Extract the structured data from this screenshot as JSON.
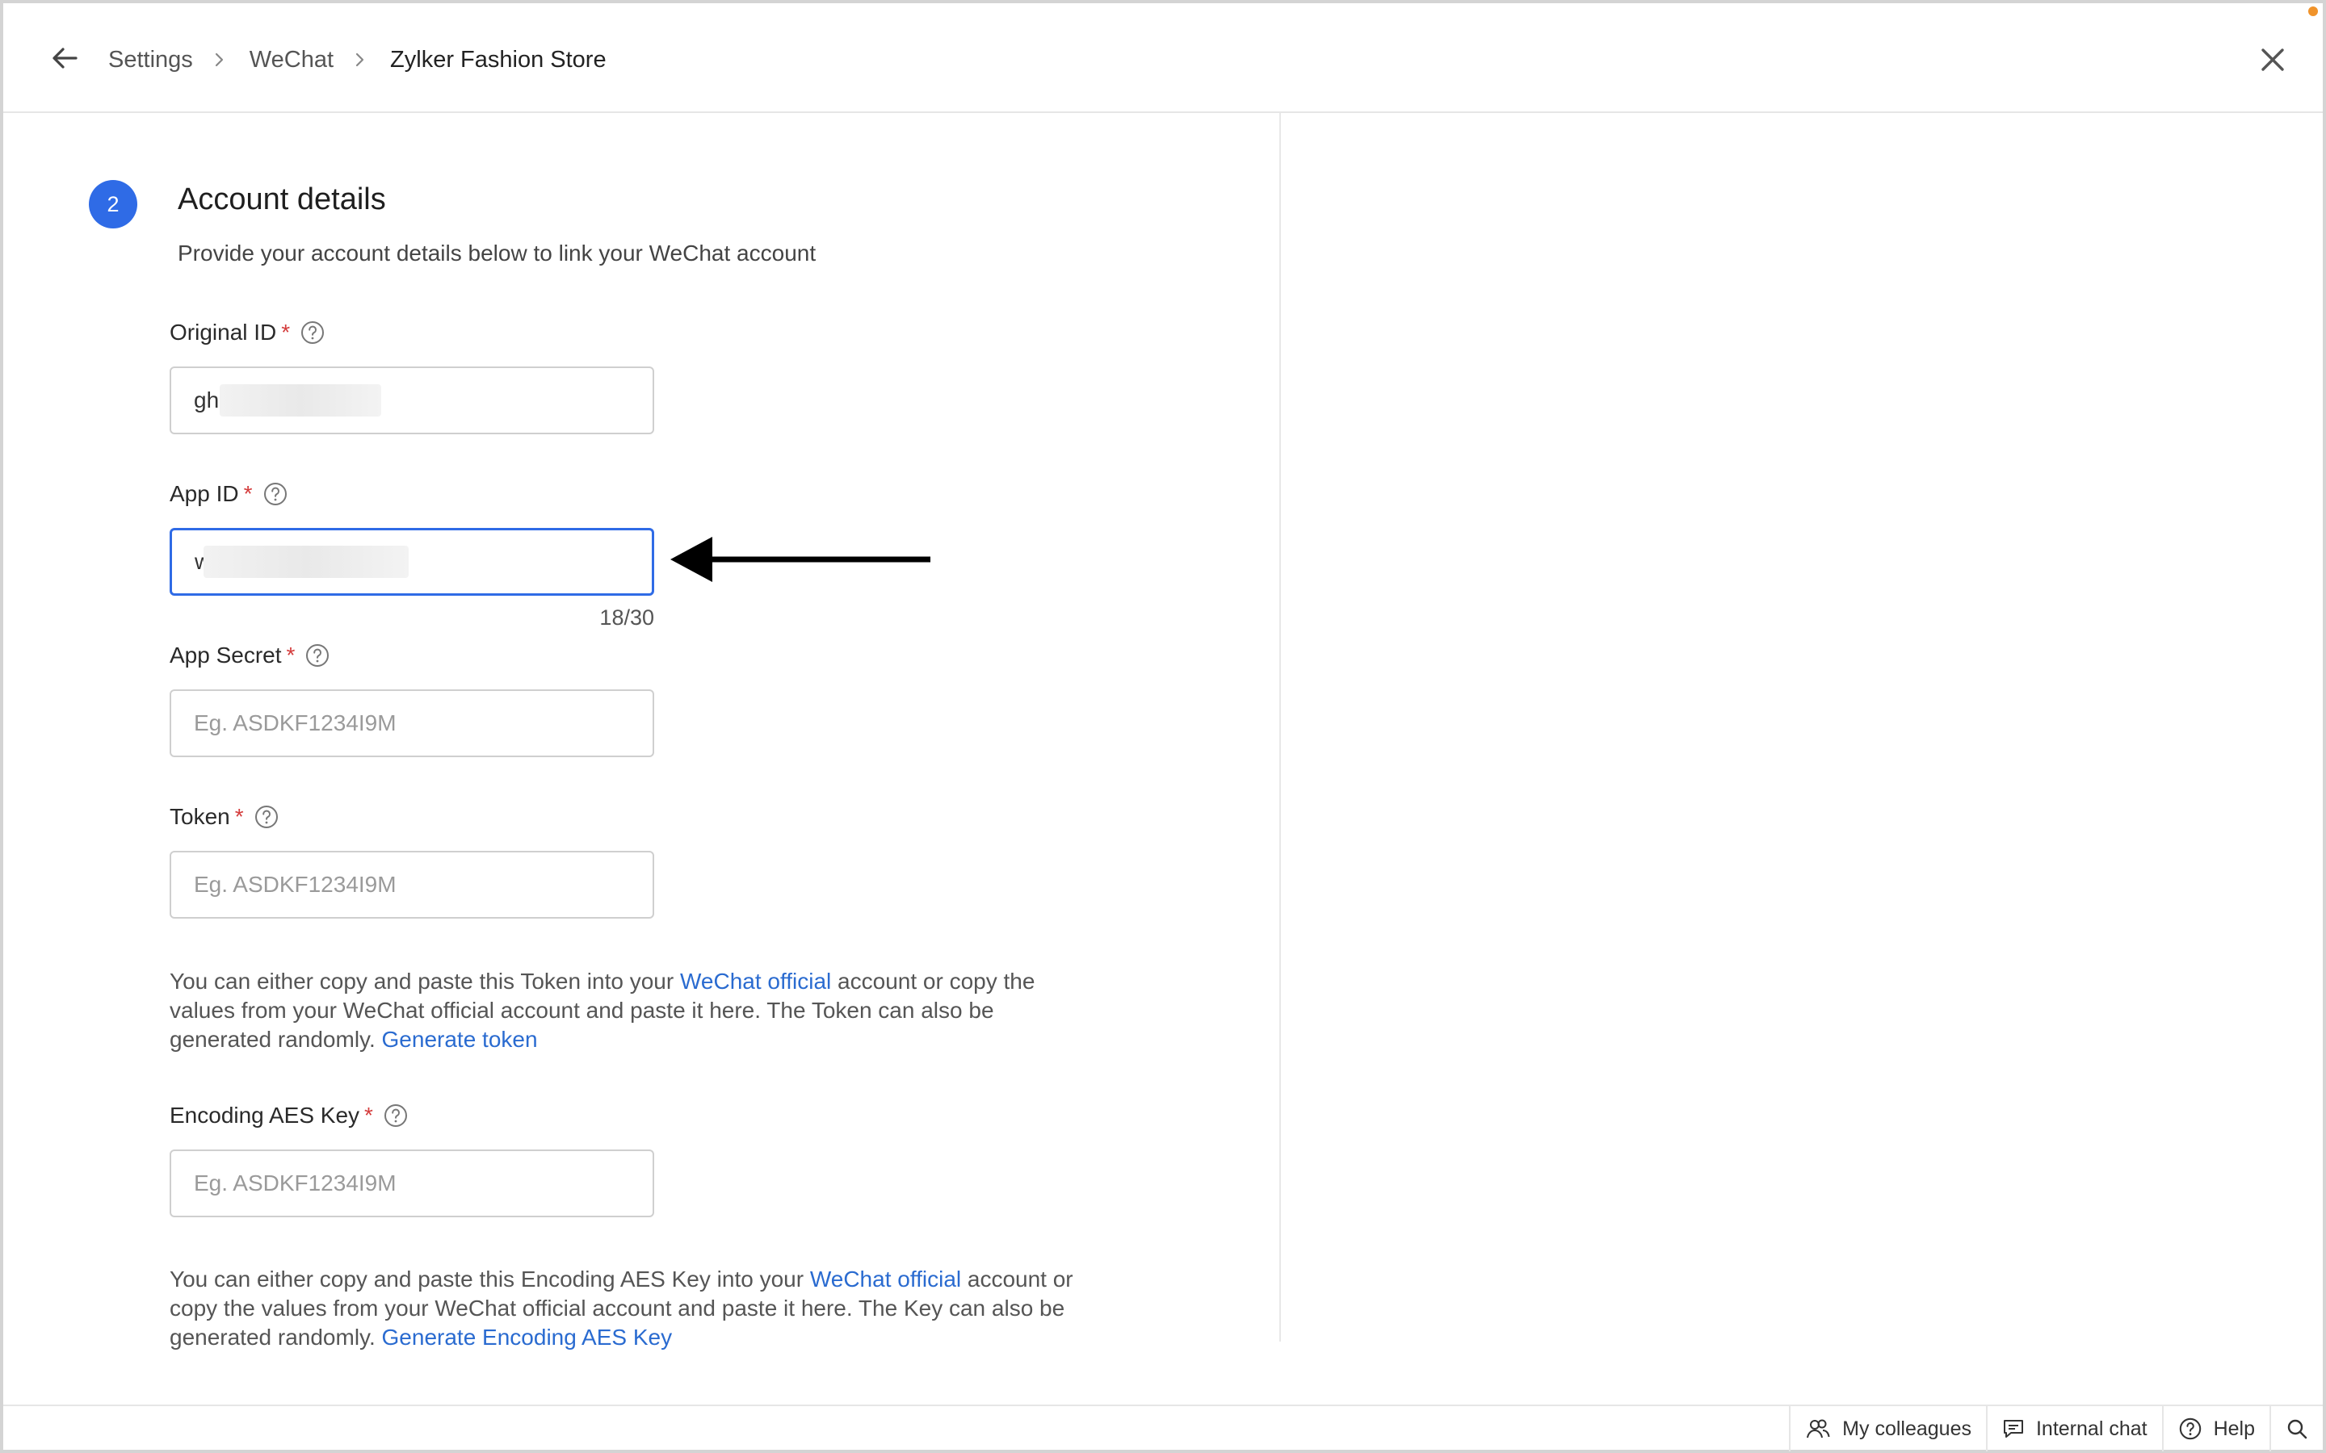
{
  "header": {
    "breadcrumbs": [
      "Settings",
      "WeChat",
      "Zylker Fashion Store"
    ]
  },
  "icons": {
    "back": "arrow-left-icon",
    "close": "close-icon",
    "help": "question-circle-icon",
    "breadcrumb_separator": "chevron-right-icon"
  },
  "section": {
    "step_number": "2",
    "title": "Account details",
    "subtitle": "Provide your account details below to link your WeChat account"
  },
  "fields": {
    "original_id": {
      "label": "Original ID",
      "required_mark": "*",
      "value": "gh a"
    },
    "app_id": {
      "label": "App ID",
      "required_mark": "*",
      "value": "w f",
      "counter": "18/30"
    },
    "app_secret": {
      "label": "App Secret",
      "required_mark": "*",
      "placeholder": "Eg. ASDKF1234I9M"
    },
    "token": {
      "label": "Token",
      "required_mark": "*",
      "placeholder": "Eg. ASDKF1234I9M"
    },
    "encoding_aes_key": {
      "label": "Encoding AES Key",
      "required_mark": "*",
      "placeholder": "Eg. ASDKF1234I9M"
    }
  },
  "token_help": {
    "part1": "You can either copy and paste this Token into your ",
    "link1": "WeChat official",
    "part2": " account or copy the values from your WeChat official account and paste it here. The Token can also be generated randomly. ",
    "link2": "Generate token"
  },
  "aes_help": {
    "part1": "You can either copy and paste this Encoding AES Key into your ",
    "link1": "WeChat official",
    "part2": " account or copy the values from your WeChat official account and paste it here. The Key can also be generated randomly. ",
    "link2": "Generate Encoding AES Key"
  },
  "footer": {
    "colleagues": "My colleagues",
    "internal_chat": "Internal chat",
    "help": "Help"
  },
  "colors": {
    "accent": "#2f6be6",
    "link": "#2a6bd0",
    "required": "#d43c3c",
    "status_dot": "#f0932b"
  }
}
